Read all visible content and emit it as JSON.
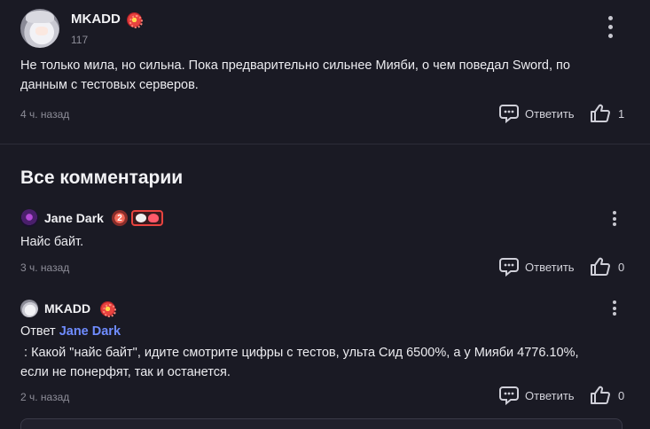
{
  "top_comment": {
    "username": "MKADD",
    "level": "117",
    "text_line1": "Не только мила, но сильна. Пока предварительно сильнее Мияби, о чем поведал Sword, по",
    "text_line2": "данным с тестовых серверов.",
    "time": "4 ч. назад",
    "reply_label": "Ответить",
    "likes": "1"
  },
  "section": {
    "title": "Все комментарии"
  },
  "comments": [
    {
      "username": "Jane Dark",
      "level_badge": "2",
      "text": "Найс байт.",
      "time": "3 ч. назад",
      "reply_label": "Ответить",
      "likes": "0"
    },
    {
      "username": "MKADD",
      "reply_prefix": "Ответ",
      "reply_to": "Jane Dark",
      "text_line1": " : Какой \"найс байт\", идите смотрите цифры с тестов, ульта Сид 6500%, а у Мияби 4776.10%,",
      "text_line2": "если не понерфят, так и останется.",
      "time": "2 ч. назад",
      "reply_label": "Ответить",
      "likes": "0"
    }
  ],
  "icons": {
    "menu": "more-vertical-icon",
    "reply": "comment-bubble-icon",
    "like": "thumbs-up-icon"
  },
  "colors": {
    "background": "#1a1a24",
    "mention": "#6f8cff",
    "muted": "#8d8d98"
  }
}
